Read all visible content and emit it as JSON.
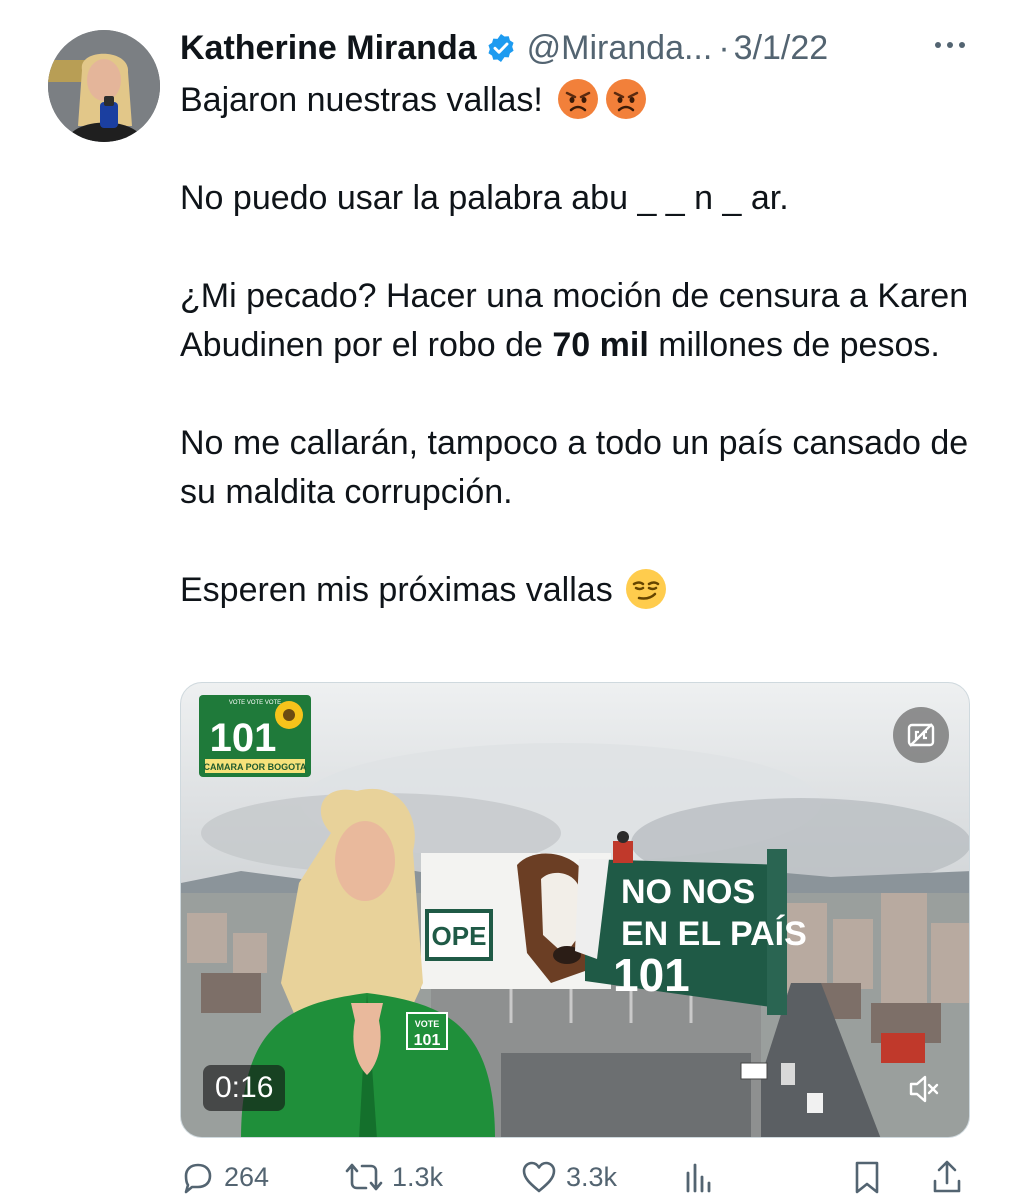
{
  "tweet": {
    "author": {
      "display_name": "Katherine Miranda",
      "handle": "@Miranda...",
      "separator": "·",
      "date": "3/1/22",
      "verified_icon": "verified-badge-icon",
      "avatar": "avatar"
    },
    "text": {
      "line1": "Bajaron nuestras vallas!",
      "line1_emojis": [
        "angry-face-emoji",
        "angry-face-emoji"
      ],
      "line2": "No puedo usar la palabra abu _ _ n _ ar.",
      "line3_before": "¿Mi pecado? Hacer una moción de censura a Karen Abudinen por el robo de ",
      "line3_bold": "70 mil",
      "line3_after": " millones de pesos.",
      "line4": "No me callarán, tampoco a todo un país cansado de su maldita corrupción.",
      "line5": "Esperen mis próximas vallas",
      "line5_emoji": "smirking-face-emoji"
    },
    "media": {
      "duration": "0:16",
      "logo": {
        "top_text": "VOTE VOTE VOTE",
        "number": "101",
        "bottom_text": "CAMARA POR BOGOTA"
      },
      "billboard": {
        "line1": "NO NOS",
        "line2": "EN EL PAÍS",
        "number": "101",
        "side_text": "OPE"
      },
      "jacket_text": {
        "vote": "VOTE",
        "number": "101"
      },
      "captions_icon": "closed-captions-off-icon",
      "mute_icon": "speaker-muted-icon"
    },
    "actions": {
      "replies": "264",
      "retweets": "1.3k",
      "likes": "3.3k",
      "icons": [
        "reply-icon",
        "retweet-icon",
        "like-icon",
        "views-icon",
        "bookmark-icon",
        "share-icon"
      ]
    },
    "colors": {
      "text": "#0f1419",
      "secondary": "#536471",
      "verified": "#1d9bf0",
      "campaign_green": "#1f7a3a"
    }
  }
}
